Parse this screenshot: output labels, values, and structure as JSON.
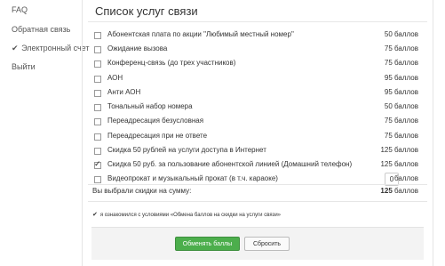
{
  "sidebar": {
    "items": [
      {
        "label": "FAQ"
      },
      {
        "label": "Обратная связь"
      },
      {
        "label": "Электронный счет",
        "icon": "check-icon"
      },
      {
        "label": "Выйти"
      }
    ]
  },
  "main": {
    "title": "Список услуг связи",
    "services": [
      {
        "label": "Абонентская плата по акции \"Любимый местный номер\"",
        "price": "50 баллов",
        "checked": false
      },
      {
        "label": "Ожидание вызова",
        "price": "75 баллов",
        "checked": false
      },
      {
        "label": "Конференц-связь (до трех участников)",
        "price": "75 баллов",
        "checked": false
      },
      {
        "label": "АОН",
        "price": "95 баллов",
        "checked": false
      },
      {
        "label": "Анти АОН",
        "price": "95 баллов",
        "checked": false
      },
      {
        "label": "Тональный набор номера",
        "price": "50 баллов",
        "checked": false
      },
      {
        "label": "Переадресация безусловная",
        "price": "75 баллов",
        "checked": false
      },
      {
        "label": "Переадресация при не ответе",
        "price": "75 баллов",
        "checked": false
      },
      {
        "label": "Скидка 50 рублей на услуги доступа в Интернет",
        "price": "125 баллов",
        "checked": false
      },
      {
        "label": "Скидка 50 руб. за пользование абонентской линией (Домашний телефон)",
        "price": "125 баллов",
        "checked": true
      },
      {
        "label": "Видеопрокат и музыкальный прокат (в т.ч. караоке)",
        "price": "баллов",
        "quantity": "0",
        "checked": false
      }
    ],
    "summary": {
      "label": "Вы выбрали скидки на сумму:",
      "value": "125",
      "unit": "баллов"
    },
    "agreement": {
      "text": "я ознакомился с условиями «Обмена баллов на скидки на услуги связи»",
      "checked": true
    },
    "buttons": {
      "exchange": "Обменять баллы",
      "reset": "Сбросить"
    }
  },
  "colors": {
    "primary_button": "#4cae4c",
    "footer_bg": "#f3f3f3"
  }
}
